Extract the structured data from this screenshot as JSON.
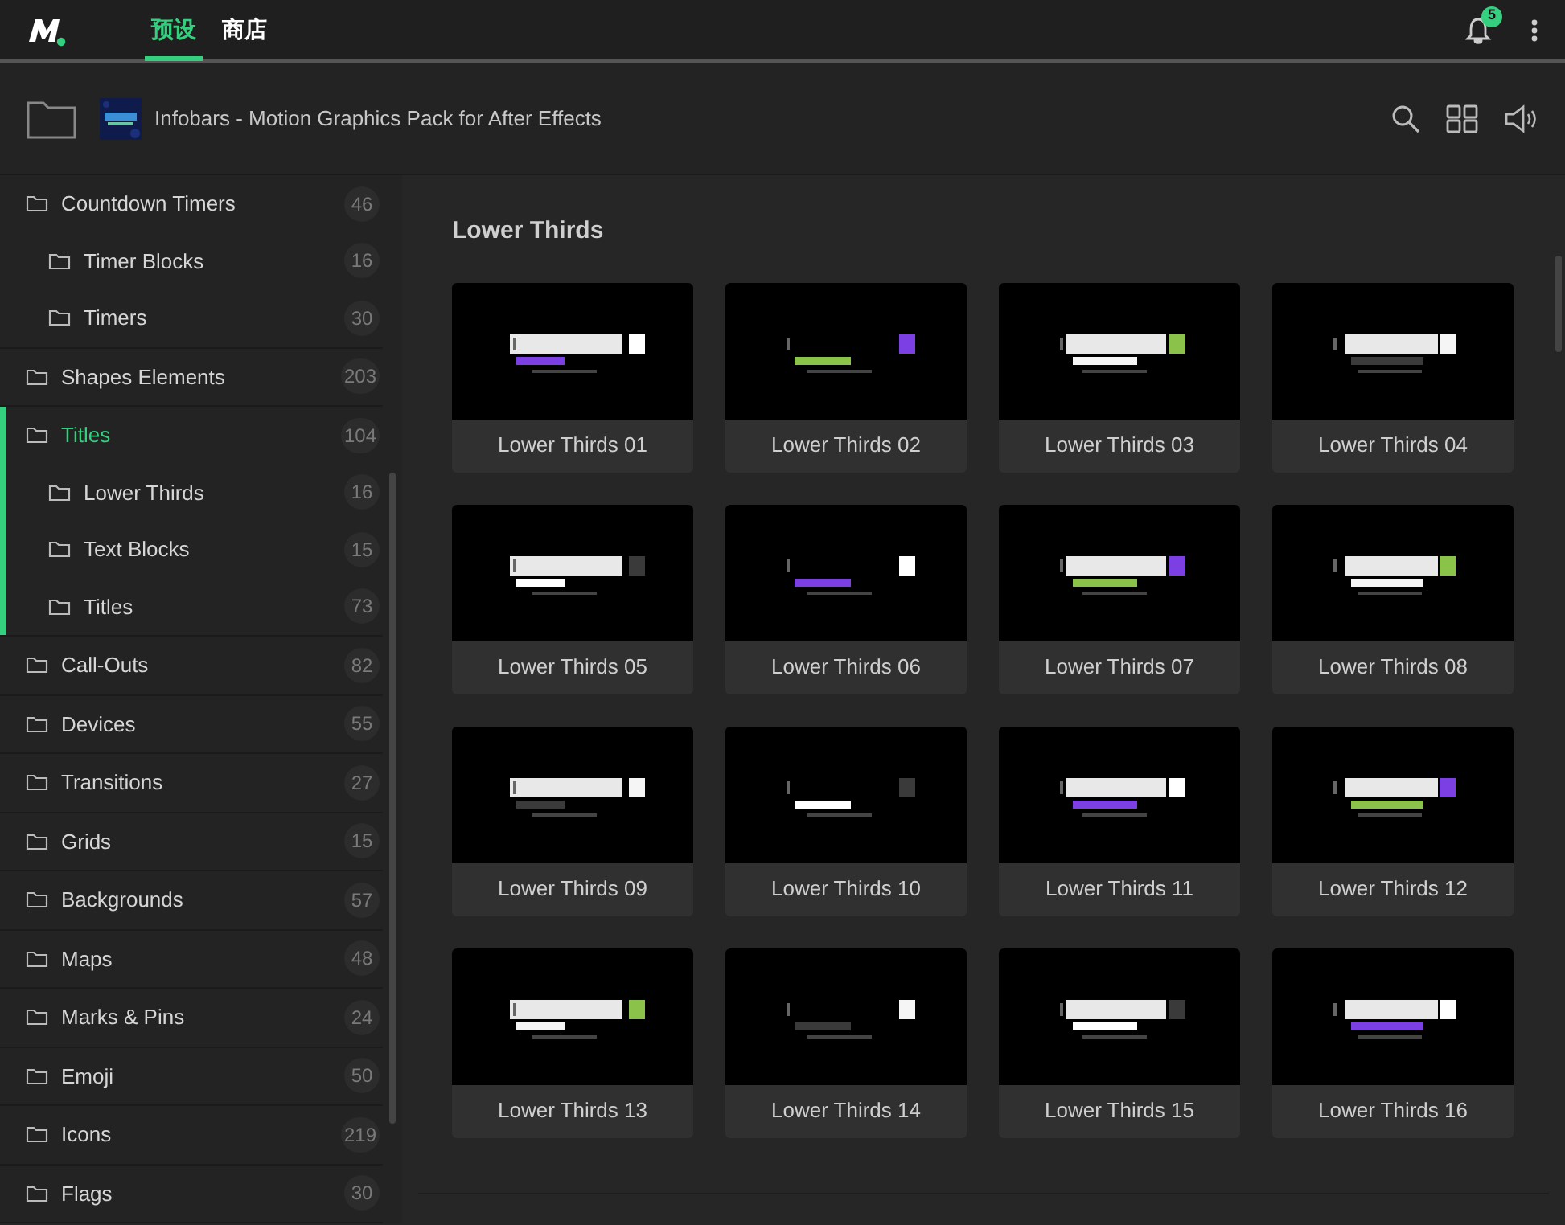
{
  "topbar": {
    "tabs": [
      {
        "label": "预设",
        "selected": true
      },
      {
        "label": "商店",
        "selected": false
      }
    ],
    "notifications": "5"
  },
  "pack": {
    "title": "Infobars - Motion Graphics Pack for After Effects"
  },
  "sidebar": {
    "items": [
      {
        "label": "Countdown Timers",
        "count": "46",
        "selected": false,
        "children": [
          {
            "label": "Timer Blocks",
            "count": "16",
            "selected": false
          },
          {
            "label": "Timers",
            "count": "30",
            "selected": false
          }
        ]
      },
      {
        "label": "Shapes Elements",
        "count": "203",
        "selected": false
      },
      {
        "label": "Titles",
        "count": "104",
        "selected": true,
        "children": [
          {
            "label": "Lower Thirds",
            "count": "16",
            "selected": false
          },
          {
            "label": "Text Blocks",
            "count": "15",
            "selected": false
          },
          {
            "label": "Titles",
            "count": "73",
            "selected": false
          }
        ]
      },
      {
        "label": "Call-Outs",
        "count": "82",
        "selected": false
      },
      {
        "label": "Devices",
        "count": "55",
        "selected": false
      },
      {
        "label": "Transitions",
        "count": "27",
        "selected": false
      },
      {
        "label": "Grids",
        "count": "15",
        "selected": false
      },
      {
        "label": "Backgrounds",
        "count": "57",
        "selected": false
      },
      {
        "label": "Maps",
        "count": "48",
        "selected": false
      },
      {
        "label": "Marks & Pins",
        "count": "24",
        "selected": false
      },
      {
        "label": "Emoji",
        "count": "50",
        "selected": false
      },
      {
        "label": "Icons",
        "count": "219",
        "selected": false
      },
      {
        "label": "Flags",
        "count": "30",
        "selected": false
      }
    ]
  },
  "section": {
    "title": "Lower Thirds",
    "cards": [
      {
        "label": "Lower Thirds 01"
      },
      {
        "label": "Lower Thirds 02"
      },
      {
        "label": "Lower Thirds 03"
      },
      {
        "label": "Lower Thirds 04"
      },
      {
        "label": "Lower Thirds 05"
      },
      {
        "label": "Lower Thirds 06"
      },
      {
        "label": "Lower Thirds 07"
      },
      {
        "label": "Lower Thirds 08"
      },
      {
        "label": "Lower Thirds 09"
      },
      {
        "label": "Lower Thirds 10"
      },
      {
        "label": "Lower Thirds 11"
      },
      {
        "label": "Lower Thirds 12"
      },
      {
        "label": "Lower Thirds 13"
      },
      {
        "label": "Lower Thirds 14"
      },
      {
        "label": "Lower Thirds 15"
      },
      {
        "label": "Lower Thirds 16"
      }
    ]
  }
}
